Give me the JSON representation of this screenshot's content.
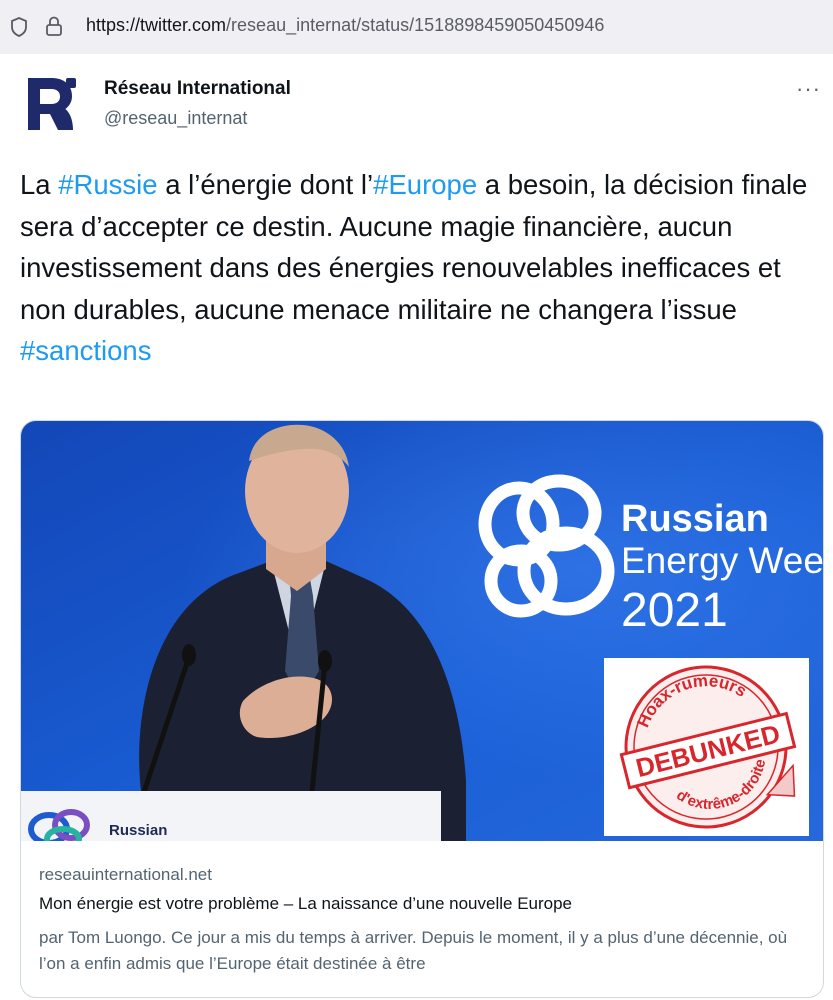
{
  "browser": {
    "url_host": "https://twitter.com",
    "url_path": "/reseau_internat/status/1518898459050450946"
  },
  "tweet": {
    "display_name": "Réseau International",
    "handle": "@reseau_internat",
    "more_label": "···",
    "text_parts": [
      {
        "t": "La ",
        "tag": false
      },
      {
        "t": "#Russie",
        "tag": true
      },
      {
        "t": " a l’énergie dont l’",
        "tag": false
      },
      {
        "t": "#Europe",
        "tag": true
      },
      {
        "t": " a besoin, la décision finale sera d’accepter ce destin. Aucune magie financière, aucun investissement dans des énergies renouvelables inefficaces et non durables, aucune menace militaire ne changera l’issue ",
        "tag": false
      },
      {
        "t": "#sanctions",
        "tag": true
      }
    ],
    "link_color": "#1d9bf0"
  },
  "card": {
    "image": {
      "backdrop_line1": "Russian",
      "backdrop_line2": "Energy Week",
      "backdrop_year": "2021",
      "podium_text": "Russian",
      "background_color": "#1656c9"
    },
    "domain": "reseauinternational.net",
    "title": "Mon énergie est votre problème – La naissance d’une nouvelle Europe",
    "description": "par Tom Luongo. Ce jour a mis du temps à arriver. Depuis le moment, il y a plus d’une décennie, où l’on a enfin admis que l’Europe était destinée à être"
  },
  "stamp": {
    "top_text": "Hoax-rumeurs",
    "center_text": "DEBUNKED",
    "bottom_text": "d'extrême-droite",
    "color": "#d8262c"
  }
}
